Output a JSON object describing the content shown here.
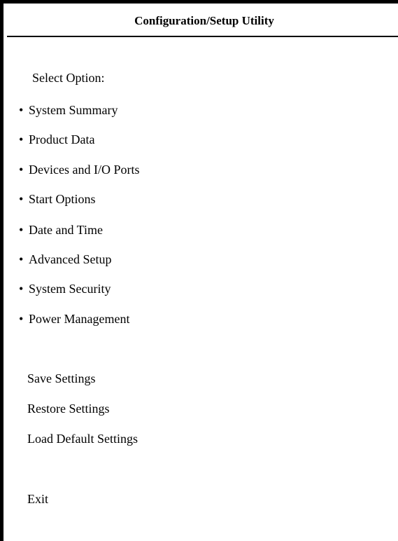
{
  "header": {
    "title": "Configuration/Setup Utility"
  },
  "menu": {
    "prompt": "Select Option:",
    "bullet": "•",
    "items": [
      {
        "label": "System Summary"
      },
      {
        "label": "Product Data"
      },
      {
        "label": "Devices and I/O Ports"
      },
      {
        "label": "Start Options"
      },
      {
        "label": "Date and Time"
      },
      {
        "label": "Advanced Setup"
      },
      {
        "label": "System Security"
      },
      {
        "label": "Power Management"
      }
    ]
  },
  "actions": {
    "save": "Save Settings",
    "restore": "Restore Settings",
    "load_default": "Load Default Settings",
    "exit": "Exit"
  },
  "colors": {
    "background": "#ffffff",
    "text": "#000000",
    "border": "#000000"
  }
}
